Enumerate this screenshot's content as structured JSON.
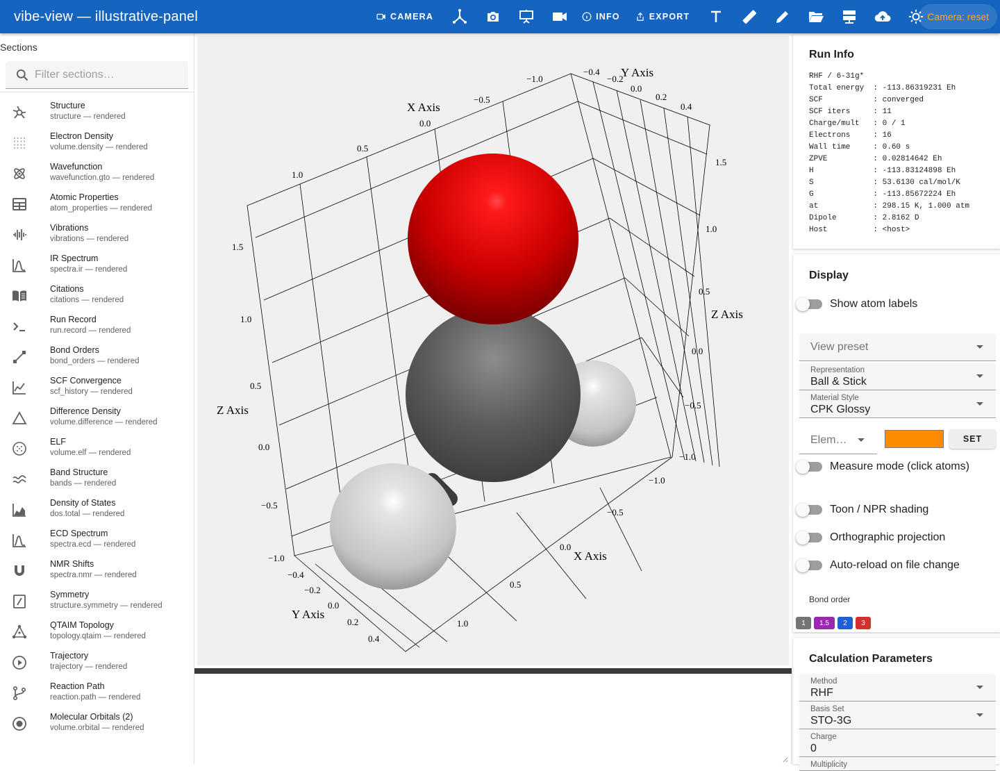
{
  "app": {
    "title": "vibe-view — illustrative-panel"
  },
  "toolbar": {
    "camera_label": "CAMERA",
    "info_label": "INFO",
    "export_label": "EXPORT",
    "camera_status": "Camera: reset"
  },
  "sidebar": {
    "heading": "Sections",
    "search_placeholder": "Filter sections…",
    "items": [
      {
        "title": "Structure",
        "subtitle": "structure — rendered",
        "icon": "molecule-icon"
      },
      {
        "title": "Electron Density",
        "subtitle": "volume.density — rendered",
        "icon": "dot-grid-icon"
      },
      {
        "title": "Wavefunction",
        "subtitle": "wavefunction.gto — rendered",
        "icon": "atom-icon"
      },
      {
        "title": "Atomic Properties",
        "subtitle": "atom_properties — rendered",
        "icon": "table-icon"
      },
      {
        "title": "Vibrations",
        "subtitle": "vibrations — rendered",
        "icon": "waveform-icon"
      },
      {
        "title": "IR Spectrum",
        "subtitle": "spectra.ir — rendered",
        "icon": "spectrum-peak-icon"
      },
      {
        "title": "Citations",
        "subtitle": "citations — rendered",
        "icon": "book-icon"
      },
      {
        "title": "Run Record",
        "subtitle": "run.record — rendered",
        "icon": "terminal-icon"
      },
      {
        "title": "Bond Orders",
        "subtitle": "bond_orders — rendered",
        "icon": "bond-line-icon"
      },
      {
        "title": "SCF Convergence",
        "subtitle": "scf_history — rendered",
        "icon": "line-chart-icon"
      },
      {
        "title": "Difference Density",
        "subtitle": "volume.difference — rendered",
        "icon": "triangle-icon"
      },
      {
        "title": "ELF",
        "subtitle": "volume.elf — rendered",
        "icon": "dotted-circle-icon"
      },
      {
        "title": "Band Structure",
        "subtitle": "bands — rendered",
        "icon": "bands-icon"
      },
      {
        "title": "Density of States",
        "subtitle": "dos.total — rendered",
        "icon": "area-chart-icon"
      },
      {
        "title": "ECD Spectrum",
        "subtitle": "spectra.ecd — rendered",
        "icon": "spectrum-peak-icon"
      },
      {
        "title": "NMR Shifts",
        "subtitle": "spectra.nmr — rendered",
        "icon": "magnet-icon"
      },
      {
        "title": "Symmetry",
        "subtitle": "structure.symmetry — rendered",
        "icon": "symmetry-icon"
      },
      {
        "title": "QTAIM Topology",
        "subtitle": "topology.qtaim — rendered",
        "icon": "graph-icon"
      },
      {
        "title": "Trajectory",
        "subtitle": "trajectory — rendered",
        "icon": "play-circle-icon"
      },
      {
        "title": "Reaction Path",
        "subtitle": "reaction.path — rendered",
        "icon": "branch-icon"
      },
      {
        "title": "Molecular Orbitals (2)",
        "subtitle": "volume.orbital — rendered",
        "icon": "orbital-icon"
      }
    ]
  },
  "viewer": {
    "x_axis_label": "X Axis",
    "y_axis_label": "Y Axis",
    "z_axis_label": "Z Axis",
    "atoms": [
      {
        "element": "O",
        "color": "#cc0000"
      },
      {
        "element": "C",
        "color": "#5a5a5a"
      },
      {
        "element": "H",
        "color": "#e0e0e0"
      },
      {
        "element": "H",
        "color": "#e0e0e0"
      }
    ]
  },
  "run_info": {
    "title": "Run Info",
    "lines": [
      "RHF / 6-31g*",
      "Total energy  : -113.86319231 Eh",
      "SCF           : converged",
      "SCF iters     : 11",
      "Charge/mult   : 0 / 1",
      "Electrons     : 16",
      "Wall time     : 0.60 s",
      "ZPVE          : 0.02814642 Eh",
      "H             : -113.83124898 Eh",
      "S             : 53.6130 cal/mol/K",
      "G             : -113.85672224 Eh",
      "at            : 298.15 K, 1.000 atm",
      "Dipole        : 2.8162 D",
      "Host          : <host>"
    ]
  },
  "display": {
    "title": "Display",
    "show_atom_labels": "Show atom labels",
    "view_preset_placeholder": "View preset",
    "representation_label": "Representation",
    "representation_value": "Ball & Stick",
    "material_label": "Material Style",
    "material_value": "CPK Glossy",
    "element_placeholder": "Elem…",
    "element_color": "#ff8c00",
    "set_label": "SET",
    "measure_mode": "Measure mode (click atoms)",
    "toon_shading": "Toon / NPR shading",
    "ortho_projection": "Orthographic projection",
    "auto_reload": "Auto-reload on file change",
    "bond_order_label": "Bond order",
    "bond_orders": [
      {
        "label": "1",
        "color": "#757575"
      },
      {
        "label": "1.5",
        "color": "#9c27b0"
      },
      {
        "label": "2",
        "color": "#1e5fd4"
      },
      {
        "label": "3",
        "color": "#d32f2f"
      }
    ]
  },
  "calc_params": {
    "title": "Calculation Parameters",
    "method_label": "Method",
    "method_value": "RHF",
    "basis_label": "Basis Set",
    "basis_value": "STO-3G",
    "charge_label": "Charge",
    "charge_value": "0",
    "multiplicity_label": "Multiplicity"
  }
}
